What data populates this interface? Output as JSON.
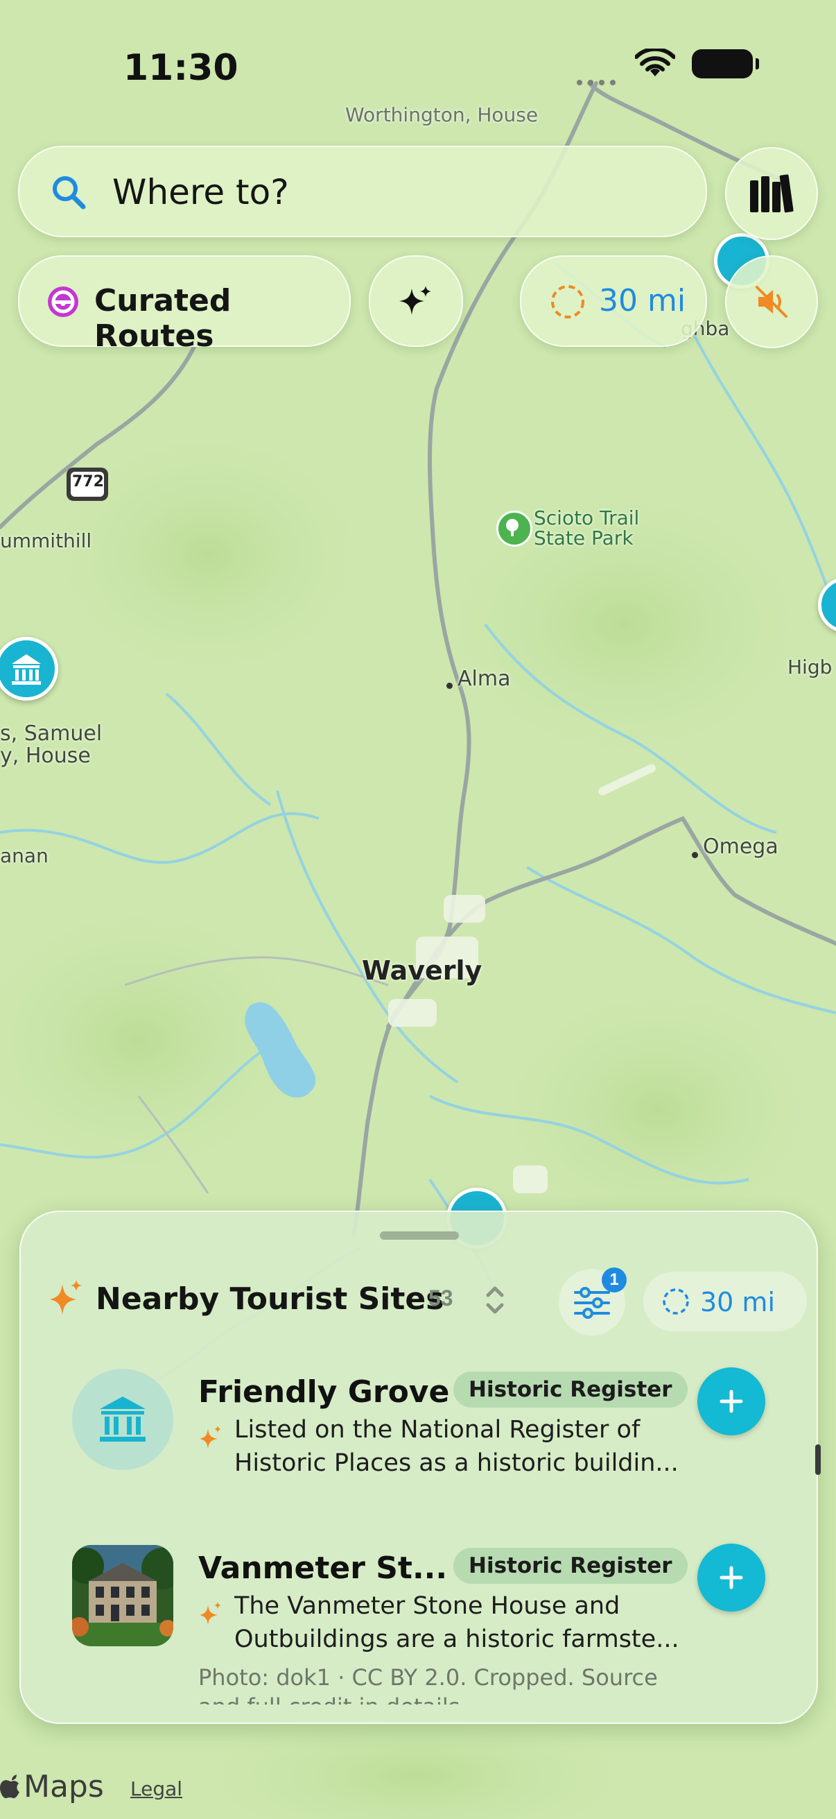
{
  "status_bar": {
    "time": "11:30"
  },
  "search": {
    "placeholder": "Where to?"
  },
  "chips": {
    "curated_routes": "Curated Routes",
    "radius": "30 mi"
  },
  "map": {
    "labels": {
      "worthington": "Worthington, House",
      "summithill": "ummithill",
      "scioto_line1": "Scioto Trail",
      "scioto_line2": "State Park",
      "alma": "Alma",
      "samuel_line1": "s, Samuel",
      "samuel_line2": "y, House",
      "anan": "anan",
      "omega": "Omega",
      "waverly": "Waverly",
      "higb": "Higb",
      "highba": "ghba",
      "route_shield": "772"
    }
  },
  "sheet": {
    "title": "Nearby Tourist Sites",
    "count": "53",
    "filter_badge": "1",
    "radius": "30 mi",
    "items": [
      {
        "name": "Friendly Grove",
        "tag": "Historic Register",
        "desc_line1": "Listed on the National Register of",
        "desc_line2": "Historic Places as a historic buildin..."
      },
      {
        "name": "Vanmeter St...",
        "tag": "Historic Register",
        "desc_line1": "The Vanmeter Stone House and",
        "desc_line2": "Outbuildings are a historic farmste...",
        "credit_line1": "Photo: dok1 · CC BY 2.0. Cropped. Source",
        "credit_line2": "and full credit in details"
      }
    ]
  },
  "footer": {
    "maps": "Maps",
    "legal": "Legal"
  },
  "colors": {
    "accent": "#1f8be0",
    "pin": "#19b4d1",
    "add": "#14b9d3",
    "sparkle": "#f08a24"
  }
}
